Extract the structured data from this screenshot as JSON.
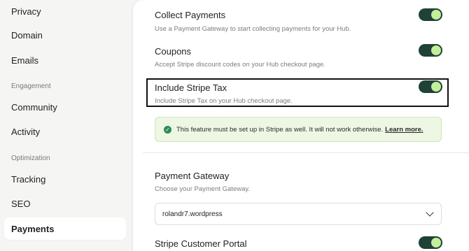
{
  "sidebar": {
    "items": [
      {
        "label": "Privacy"
      },
      {
        "label": "Domain"
      },
      {
        "label": "Emails"
      },
      {
        "label": "Community"
      },
      {
        "label": "Activity"
      },
      {
        "label": "Tracking"
      },
      {
        "label": "SEO"
      },
      {
        "label": "Payments"
      }
    ],
    "headings": [
      {
        "label": "Engagement"
      },
      {
        "label": "Optimization"
      }
    ],
    "active_item": "Payments"
  },
  "settings": {
    "collect_payments": {
      "title": "Collect Payments",
      "description": "Use a Payment Gateway to start collecting payments for your Hub.",
      "enabled": true
    },
    "coupons": {
      "title": "Coupons",
      "description": "Accept Stripe discount codes on your Hub checkout page.",
      "enabled": true
    },
    "stripe_tax": {
      "title": "Include Stripe Tax",
      "description": "Include Stripe Tax on your Hub checkout page.",
      "enabled": true
    },
    "notice": {
      "text": "This feature must be set up in Stripe as well. It will not work otherwise.",
      "link": "Learn more."
    },
    "payment_gateway": {
      "title": "Payment Gateway",
      "description": "Choose your Payment Gateway.",
      "selected": "rolandr7.wordpress"
    },
    "customer_portal": {
      "title": "Stripe Customer Portal",
      "enabled": true
    }
  },
  "colors": {
    "toggle_track": "#1f4136",
    "toggle_knob": "#c4ef9a",
    "notice_bg": "#edf7e3",
    "check": "#2e8b57"
  }
}
